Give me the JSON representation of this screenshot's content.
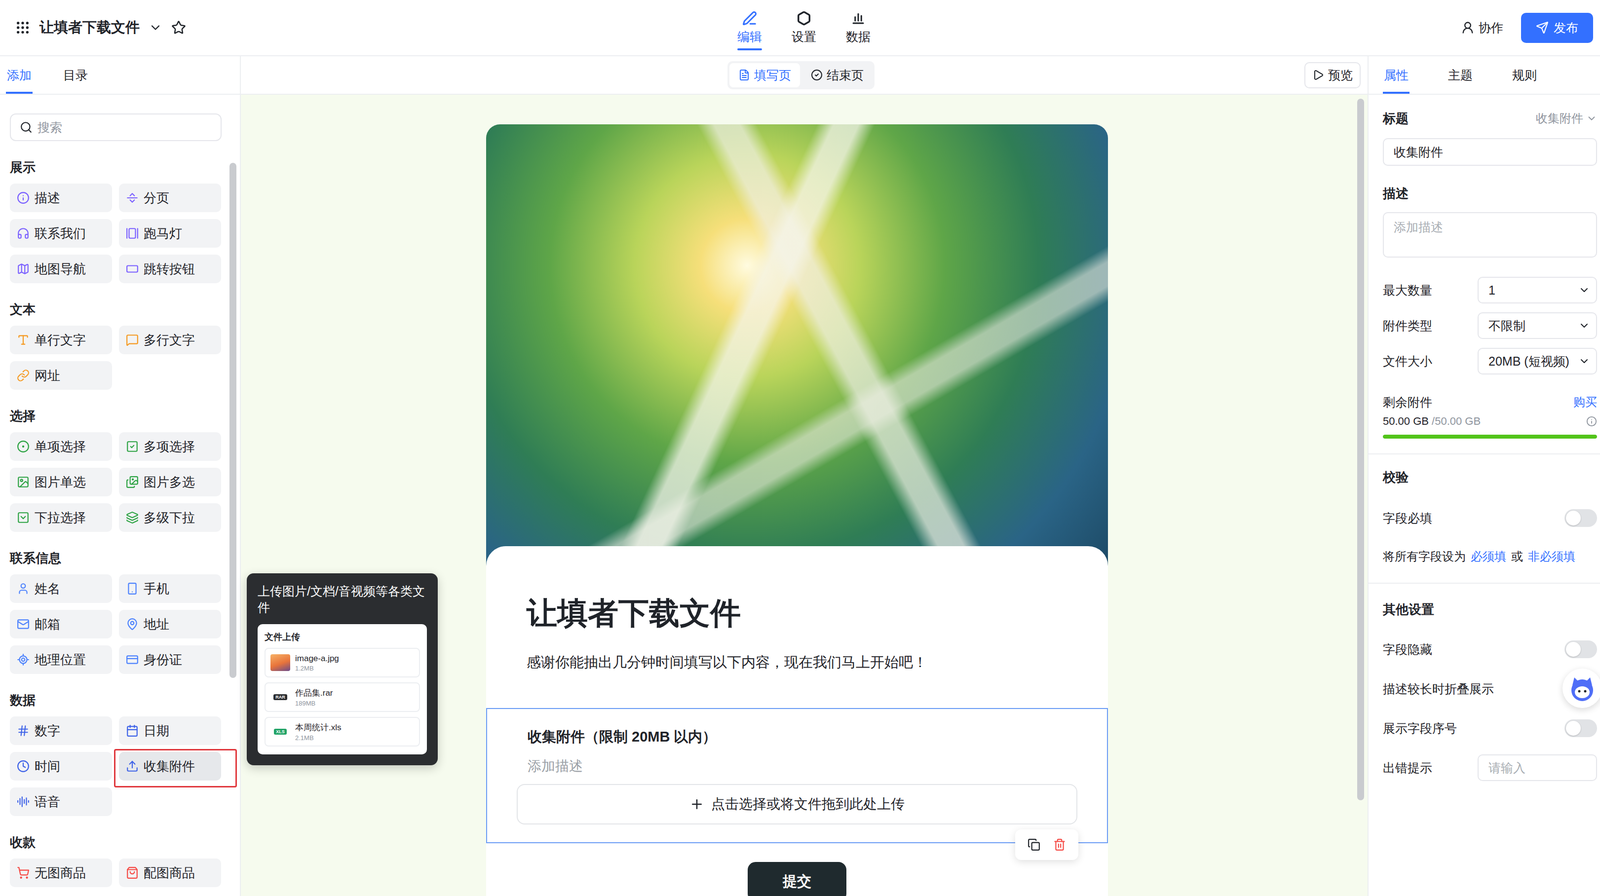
{
  "topbar": {
    "title": "让填者下载文件",
    "starred": false,
    "tabs": [
      {
        "label": "编辑",
        "selected": true
      },
      {
        "label": "设置",
        "selected": false
      },
      {
        "label": "数据",
        "selected": false
      }
    ],
    "collab": "协作",
    "publish": "发布"
  },
  "left_panel": {
    "tabs": [
      {
        "label": "添加",
        "selected": true
      },
      {
        "label": "目录",
        "selected": false
      }
    ],
    "search": {
      "placeholder": "搜索"
    },
    "sections": [
      {
        "title": "展示",
        "color": "#7b61ff",
        "items": [
          {
            "label": "描述",
            "highlighted": false
          },
          {
            "label": "分页",
            "highlighted": false
          },
          {
            "label": "联系我们",
            "highlighted": false
          },
          {
            "label": "跑马灯",
            "highlighted": false
          },
          {
            "label": "地图导航",
            "highlighted": false
          },
          {
            "label": "跳转按钮",
            "highlighted": false
          }
        ]
      },
      {
        "title": "文本",
        "color": "#f59a23",
        "items": [
          {
            "label": "单行文字",
            "highlighted": false
          },
          {
            "label": "多行文字",
            "highlighted": false
          },
          {
            "label": "网址",
            "highlighted": false
          }
        ]
      },
      {
        "title": "选择",
        "color": "#2ea344",
        "items": [
          {
            "label": "单项选择",
            "highlighted": false
          },
          {
            "label": "多项选择",
            "highlighted": false
          },
          {
            "label": "图片单选",
            "highlighted": false
          },
          {
            "label": "图片多选",
            "highlighted": false
          },
          {
            "label": "下拉选择",
            "highlighted": false
          },
          {
            "label": "多级下拉",
            "highlighted": false
          }
        ]
      },
      {
        "title": "联系信息",
        "color": "#4e83fd",
        "items": [
          {
            "label": "姓名",
            "highlighted": false
          },
          {
            "label": "手机",
            "highlighted": false
          },
          {
            "label": "邮箱",
            "highlighted": false
          },
          {
            "label": "地址",
            "highlighted": false
          },
          {
            "label": "地理位置",
            "highlighted": false
          },
          {
            "label": "身份证",
            "highlighted": false
          }
        ]
      },
      {
        "title": "数据",
        "color": "#3f63e8",
        "items": [
          {
            "label": "数字",
            "highlighted": false
          },
          {
            "label": "日期",
            "highlighted": false
          },
          {
            "label": "时间",
            "highlighted": false
          },
          {
            "label": "收集附件",
            "highlighted": true
          },
          {
            "label": "语音",
            "highlighted": false
          }
        ]
      },
      {
        "title": "收款",
        "color": "#f54a45",
        "items": [
          {
            "label": "无图商品",
            "highlighted": false
          },
          {
            "label": "配图商品",
            "highlighted": false
          }
        ]
      }
    ]
  },
  "tooltip": {
    "text": "上传图片/文档/音视频等各类文件",
    "preview": {
      "title": "文件上传",
      "files": [
        {
          "name": "image-a.jpg",
          "size": "1.2MB",
          "kind": "image",
          "badge": ""
        },
        {
          "name": "作品集.rar",
          "size": "189MB",
          "kind": "archive",
          "badge": "RAR"
        },
        {
          "name": "本周统计.xls",
          "size": "2.1MB",
          "kind": "sheet",
          "badge": "XLS"
        }
      ]
    }
  },
  "canvas": {
    "page_tabs": [
      {
        "label": "填写页",
        "selected": true
      },
      {
        "label": "结束页",
        "selected": false
      }
    ],
    "preview": "预览",
    "form": {
      "title": "让填者下载文件",
      "description": "感谢你能抽出几分钟时间填写以下内容，现在我们马上开始吧！",
      "field": {
        "title": "收集附件（限制 20MB 以内）",
        "description_placeholder": "添加描述",
        "upload": "点击选择或将文件拖到此处上传",
        "selected": true
      },
      "submit": "提交"
    }
  },
  "right_panel": {
    "tabs": [
      {
        "label": "属性",
        "selected": true
      },
      {
        "label": "主题",
        "selected": false
      },
      {
        "label": "规则",
        "selected": false
      }
    ],
    "title_field": {
      "label": "标题",
      "type": "收集附件",
      "value": "收集附件"
    },
    "description_field": {
      "label": "描述",
      "placeholder": "添加描述"
    },
    "selects": [
      {
        "label": "最大数量",
        "value": "1"
      },
      {
        "label": "附件类型",
        "value": "不限制"
      },
      {
        "label": "文件大小",
        "value": "20MB (短视频)"
      }
    ],
    "storage": {
      "label": "剩余附件",
      "action": "购买",
      "used": "50.00 GB",
      "total": "/50.00 GB",
      "level": 1
    },
    "validation": {
      "title": "校验",
      "required": {
        "label": "字段必填",
        "on": false
      },
      "bulk": {
        "label": "将所有字段设为",
        "required": "必须填",
        "or": "或",
        "optional": "非必须填"
      }
    },
    "other": {
      "title": "其他设置",
      "switches": [
        {
          "label": "字段隐藏",
          "on": false
        },
        {
          "label": "描述较长时折叠展示",
          "on": false
        },
        {
          "label": "展示字段序号",
          "on": false
        }
      ],
      "error_hint": {
        "label": "出错提示",
        "placeholder": "请输入"
      }
    }
  }
}
